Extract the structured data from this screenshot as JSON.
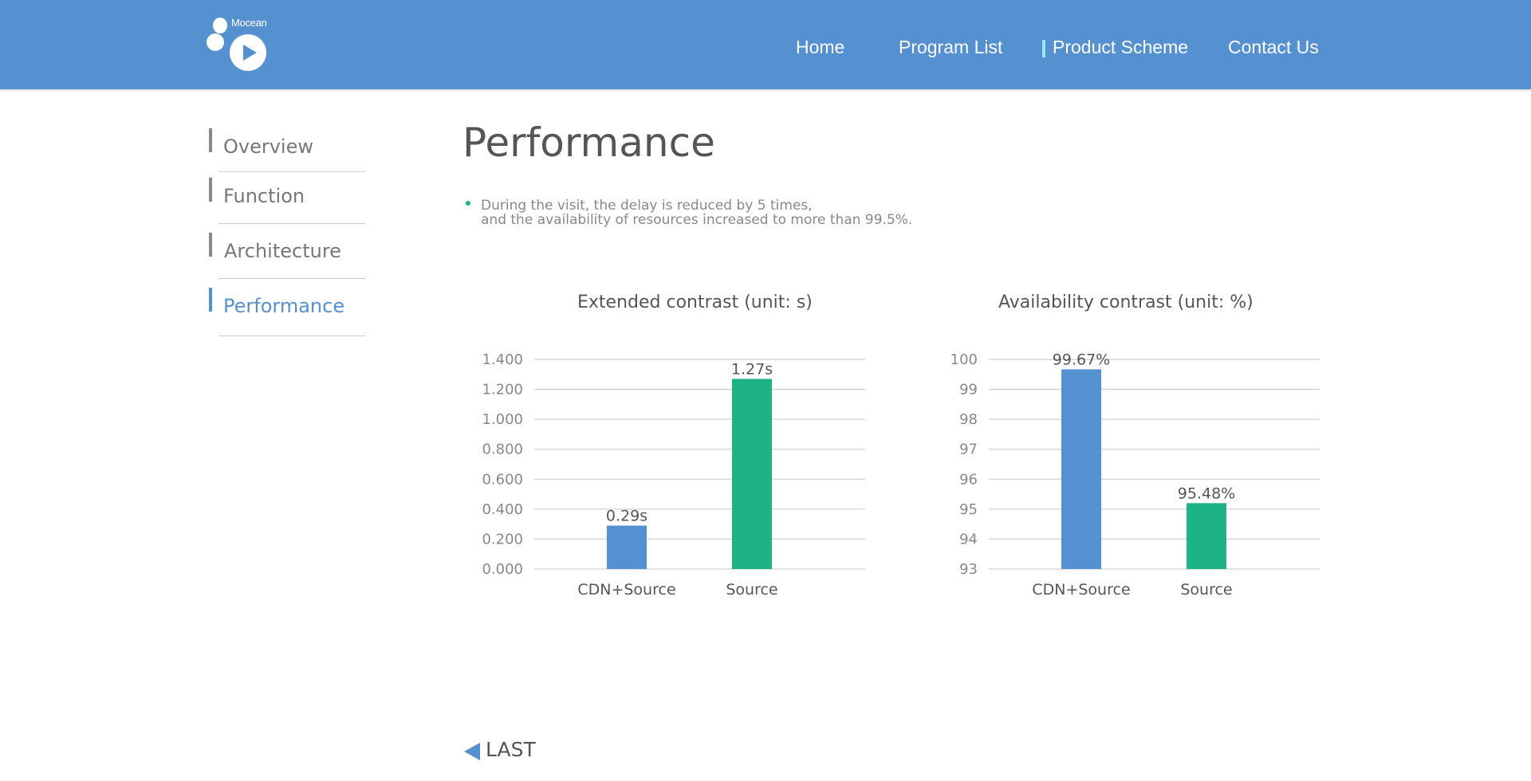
{
  "header": {
    "logo_text": "Mocean",
    "nav": [
      {
        "label": "Home"
      },
      {
        "label": "Program List"
      },
      {
        "label": "Product Scheme"
      },
      {
        "label": "Contact Us"
      }
    ]
  },
  "sidebar": {
    "items": [
      {
        "label": "Overview"
      },
      {
        "label": "Function"
      },
      {
        "label": "Architecture"
      },
      {
        "label": "Performance"
      }
    ],
    "active_label": "Performance"
  },
  "main": {
    "title": "Performance",
    "description_line1": "During the visit, the delay is reduced by 5 times,",
    "description_line2": "and the availability of resources increased to more than 99.5%.",
    "last_label": "LAST"
  },
  "colors": {
    "header_bg": "#5590d0",
    "accent_blue": "#5590d0",
    "accent_green": "#1db384"
  },
  "chart_data": [
    {
      "type": "bar",
      "title": "Extended contrast (unit: s)",
      "categories": [
        "CDN+Source",
        "Source"
      ],
      "values": [
        0.29,
        1.27
      ],
      "data_labels": [
        "0.29s",
        "1.27s"
      ],
      "bar_colors": [
        "#5590d0",
        "#1db384"
      ],
      "ylim": [
        0,
        1.4
      ],
      "yticks": [
        "0.000",
        "0.200",
        "0.400",
        "0.600",
        "0.800",
        "1.000",
        "1.200",
        "1.400"
      ],
      "grid": true
    },
    {
      "type": "bar",
      "title": "Availability contrast (unit: %)",
      "categories": [
        "CDN+Source",
        "Source"
      ],
      "values": [
        99.67,
        95.2
      ],
      "data_labels": [
        "99.67%",
        "95.48%"
      ],
      "bar_colors": [
        "#5590d0",
        "#1db384"
      ],
      "ylim": [
        93,
        100
      ],
      "yticks": [
        "93",
        "94",
        "95",
        "96",
        "97",
        "98",
        "99",
        "100"
      ],
      "grid": true
    }
  ]
}
